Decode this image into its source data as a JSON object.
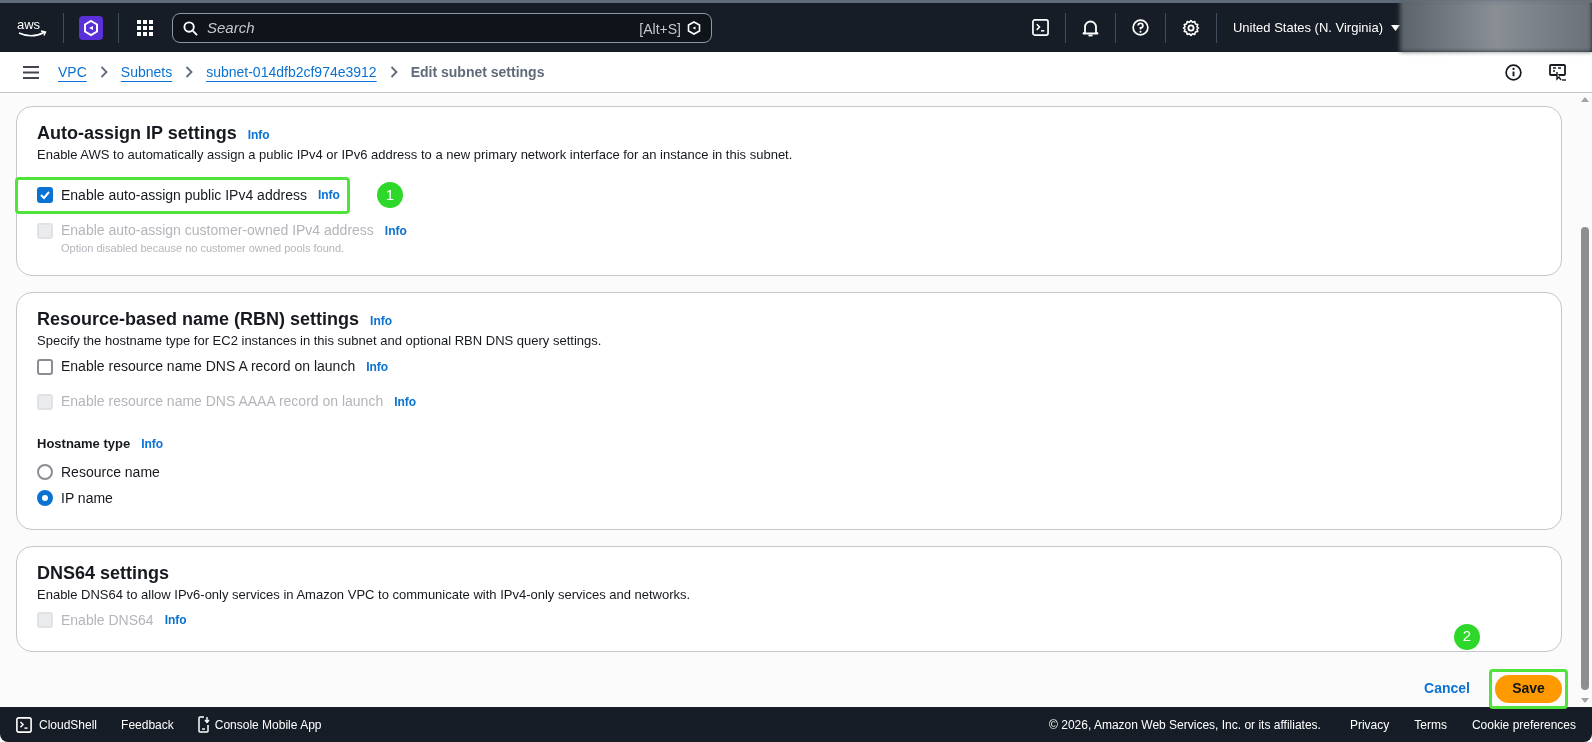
{
  "top_bar": {
    "logo_text": "aws",
    "search": {
      "placeholder": "Search",
      "shortcut": "[Alt+S]"
    },
    "region": "United States (N. Virginia)"
  },
  "breadcrumbs": [
    {
      "label": "VPC",
      "link": true
    },
    {
      "label": "Subnets",
      "link": true
    },
    {
      "label": "subnet-014dfb2cf974e3912",
      "link": true
    },
    {
      "label": "Edit subnet settings",
      "link": false
    }
  ],
  "sections": [
    {
      "title": "Auto-assign IP settings",
      "info": "Info",
      "description": "Enable AWS to automatically assign a public IPv4 or IPv6 address to a new primary network interface for an instance in this subnet.",
      "options": [
        {
          "kind": "checkbox",
          "label": "Enable auto-assign public IPv4 address",
          "info": "Info",
          "checked": true,
          "disabled": false,
          "annotation": {
            "step": "1"
          }
        },
        {
          "kind": "checkbox",
          "label": "Enable auto-assign customer-owned IPv4 address",
          "info": "Info",
          "checked": false,
          "disabled": true,
          "hint": "Option disabled because no customer owned pools found."
        }
      ]
    },
    {
      "title": "Resource-based name (RBN) settings",
      "info": "Info",
      "description": "Specify the hostname type for EC2 instances in this subnet and optional RBN DNS query settings.",
      "options": [
        {
          "kind": "checkbox",
          "label": "Enable resource name DNS A record on launch",
          "info": "Info",
          "checked": false,
          "disabled": false
        },
        {
          "kind": "checkbox",
          "label": "Enable resource name DNS AAAA record on launch",
          "info": "Info",
          "checked": false,
          "disabled": true
        },
        {
          "kind": "radio-group",
          "label": "Hostname type",
          "info": "Info",
          "choices": [
            {
              "label": "Resource name",
              "selected": false
            },
            {
              "label": "IP name",
              "selected": true
            }
          ]
        }
      ]
    },
    {
      "title": "DNS64 settings",
      "description": "Enable DNS64 to allow IPv6-only services in Amazon VPC to communicate with IPv4-only services and networks.",
      "options": [
        {
          "kind": "checkbox",
          "label": "Enable DNS64",
          "info": "Info",
          "checked": false,
          "disabled": true
        }
      ]
    }
  ],
  "actions": {
    "cancel": "Cancel",
    "save": "Save",
    "save_annotation": {
      "step": "2"
    }
  },
  "footer": {
    "left": [
      "CloudShell",
      "Feedback",
      "Console Mobile App"
    ],
    "copyright": "© 2026, Amazon Web Services, Inc. or its affiliates.",
    "links": [
      "Privacy",
      "Terms",
      "Cookie preferences"
    ]
  }
}
